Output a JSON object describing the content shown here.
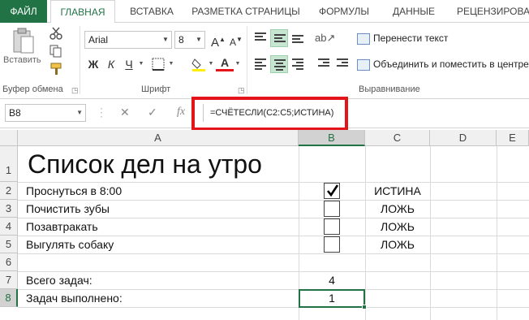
{
  "ribbon": {
    "tabs": [
      "ФАЙЛ",
      "ГЛАВНАЯ",
      "ВСТАВКА",
      "РАЗМЕТКА СТРАНИЦЫ",
      "ФОРМУЛЫ",
      "ДАННЫЕ",
      "РЕЦЕНЗИРОВАН"
    ],
    "active_tab": "ГЛАВНАЯ",
    "paste_label": "Вставить",
    "groups": {
      "clipboard": "Буфер обмена",
      "font": "Шрифт",
      "alignment": "Выравнивание"
    },
    "font_name": "Arial",
    "font_size": "8",
    "bold_label": "Ж",
    "italic_label": "К",
    "underline_label": "Ч",
    "wrap_text": "Перенести текст",
    "merge_center": "Объединить и поместить в центре",
    "accent_color": "#217346"
  },
  "formula_bar": {
    "name_box": "B8",
    "cancel_icon": "✕",
    "enter_icon": "✓",
    "fx_label": "fx",
    "formula": "=СЧЁТЕСЛИ(C2:C5;ИСТИНА)",
    "highlight_color": "#e3151a"
  },
  "sheet": {
    "columns": [
      "A",
      "B",
      "C",
      "D",
      "E"
    ],
    "rows": [
      "1",
      "2",
      "3",
      "4",
      "5",
      "6",
      "7",
      "8"
    ],
    "selected_cell": "B8",
    "cells": {
      "A1": "Список дел на утро",
      "A2": "Проснуться в 8:00",
      "A3": "Почистить зубы",
      "A4": "Позавтракать",
      "A5": "Выгулять собаку",
      "A7": "Всего задач:",
      "A8": "Задач выполнено:",
      "B7": "4",
      "B8": "1",
      "C2": "ИСТИНА",
      "C3": "ЛОЖЬ",
      "C4": "ЛОЖЬ",
      "C5": "ЛОЖЬ"
    },
    "checkboxes": [
      true,
      false,
      false,
      false
    ]
  }
}
